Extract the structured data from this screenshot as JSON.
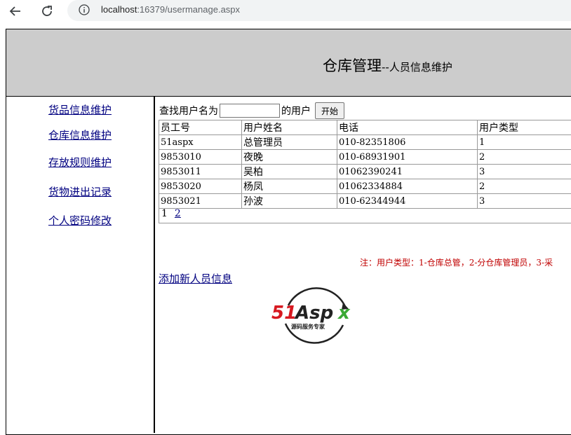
{
  "browser": {
    "url_host": "localhost",
    "url_rest": ":16379/usermanage.aspx"
  },
  "header": {
    "title_main": "仓库管理",
    "title_sub": "--人员信息维护"
  },
  "sidebar": {
    "items": [
      {
        "label": "货品信息维护"
      },
      {
        "label": "仓库信息维护"
      },
      {
        "label": "存放规则维护"
      },
      {
        "label": "货物进出记录"
      },
      {
        "label": "个人密码修改"
      }
    ]
  },
  "search": {
    "prefix": "查找用户名为",
    "suffix": "的用户",
    "value": "",
    "button": "开始"
  },
  "table": {
    "headers": [
      "员工号",
      "用户姓名",
      "电话",
      "用户类型"
    ],
    "rows": [
      [
        "51aspx",
        "总管理员",
        "010-82351806",
        "1"
      ],
      [
        "9853010",
        "夜晚",
        "010-68931901",
        "2"
      ],
      [
        "9853011",
        "吴柏",
        "01062390241",
        "3"
      ],
      [
        "9853020",
        "杨凤",
        "01062334884",
        "2"
      ],
      [
        "9853021",
        "孙波",
        "010-62344944",
        "3"
      ]
    ],
    "pages": [
      "1",
      "2"
    ]
  },
  "note": "注：用户类型：1-仓库总管，2-分仓库管理员，3-采",
  "add_link": "添加新人员信息",
  "logo": {
    "text_main": "51Aspx",
    "text_sub": "源码服务专家",
    "colors": {
      "red": "#d71920",
      "green": "#3aa935",
      "dark": "#222222"
    }
  }
}
